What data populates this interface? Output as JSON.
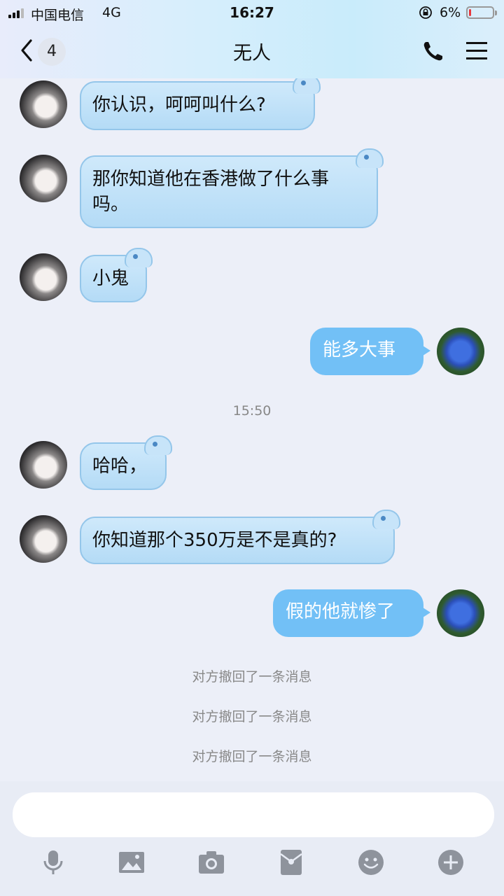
{
  "status": {
    "carrier": "中国电信",
    "network": "4G",
    "time": "16:27",
    "battery": "6%",
    "battery_level": 0.06
  },
  "header": {
    "unread_count": "4",
    "title": "无人"
  },
  "messages": [
    {
      "text": "你认识，呵呵叫什么?"
    },
    {
      "line1": "那你知道他在香港做了什么事",
      "line2": "吗。"
    },
    {
      "text": "小鬼"
    },
    {
      "text": "能多大事"
    },
    {
      "text": "哈哈，"
    },
    {
      "text": "你知道那个350万是不是真的?"
    },
    {
      "text": "假的他就惨了"
    }
  ],
  "timestamp": "15:50",
  "system_notices": [
    "对方撤回了一条消息",
    "对方撤回了一条消息",
    "对方撤回了一条消息"
  ],
  "input": {
    "value": ""
  },
  "toolbar_icons": [
    "microphone-icon",
    "image-icon",
    "camera-icon",
    "red-packet-icon",
    "emoji-icon",
    "plus-icon"
  ],
  "colors": {
    "my_bubble": "#72c0f6",
    "their_bubble": "#b4dbf6",
    "battery_low": "#e8383d"
  }
}
